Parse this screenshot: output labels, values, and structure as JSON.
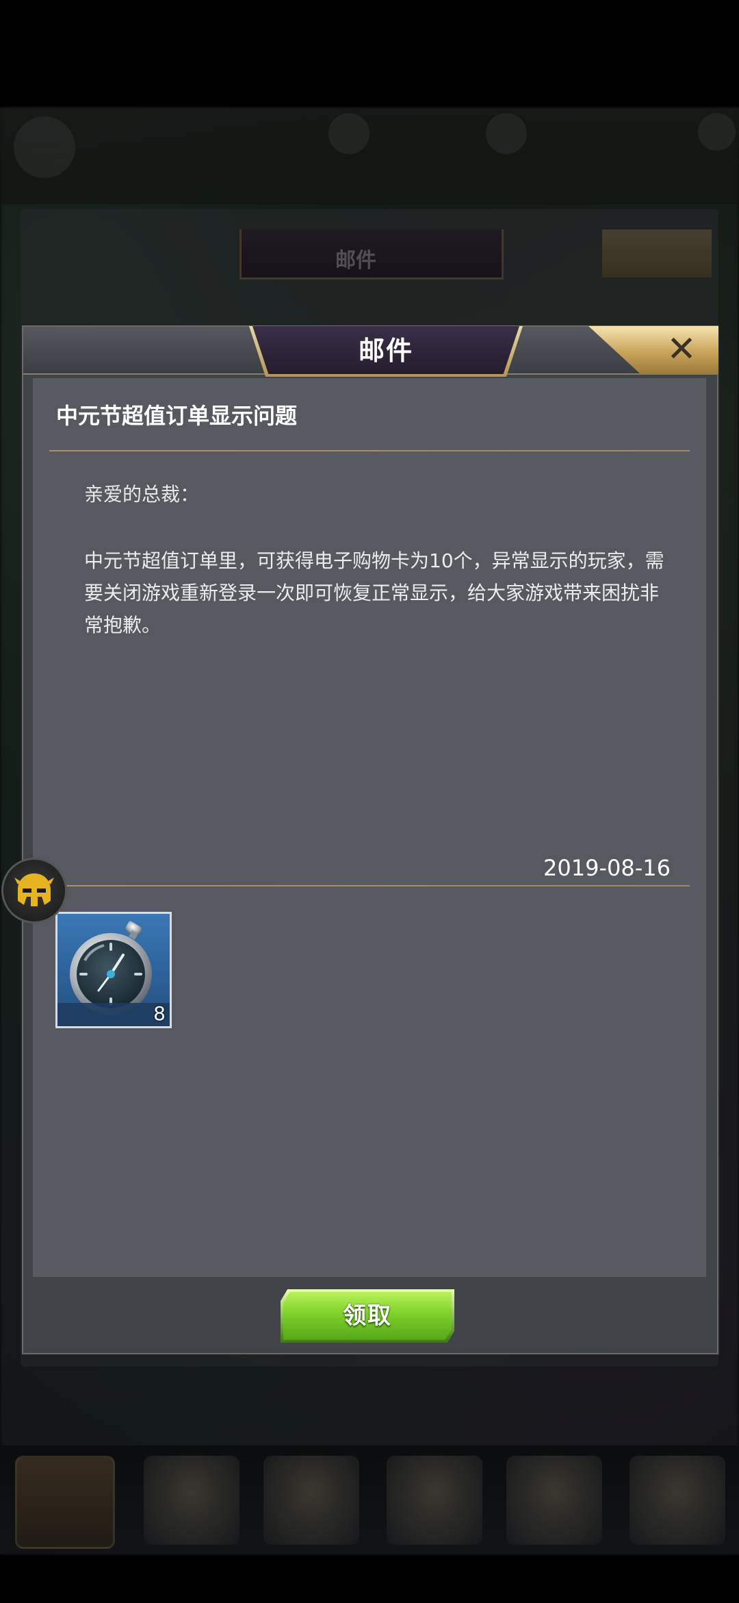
{
  "dialog": {
    "title": "邮件",
    "close_label": "✕"
  },
  "mail": {
    "subject": "中元节超值订单显示问题",
    "greeting": "亲爱的总裁：",
    "body": "中元节超值订单里，可获得电子购物卡为10个，异常显示的玩家，需要关闭游戏重新登录一次即可恢复正常显示，给大家游戏带来困扰非常抱歉。",
    "date": "2019-08-16"
  },
  "attachment": {
    "icon": "stopwatch-icon",
    "count": "8"
  },
  "actions": {
    "claim_label": "领取"
  },
  "background": {
    "title": "邮件"
  },
  "colors": {
    "claim_button": "#7fd12a",
    "title_plate": "#2d2438",
    "close_tab": "#c9a45c",
    "divider": "#be9664",
    "dialog_bg": "#404348",
    "content_bg": "#56595f"
  },
  "floating_button": {
    "icon": "helmet-icon"
  }
}
